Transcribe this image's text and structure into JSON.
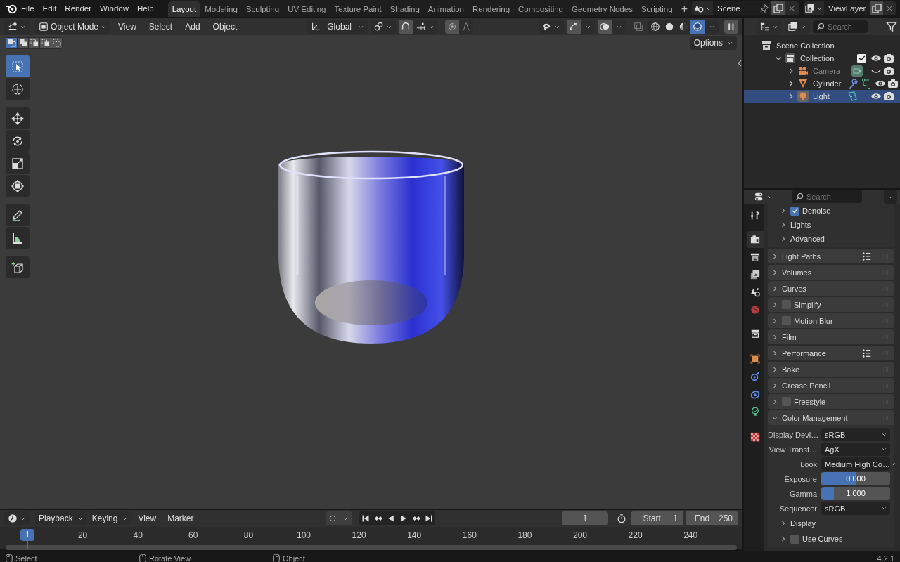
{
  "top_bar": {
    "menus": [
      "File",
      "Edit",
      "Render",
      "Window",
      "Help"
    ],
    "workspaces": [
      {
        "label": "Layout",
        "selected": true
      },
      {
        "label": "Modeling",
        "selected": false
      },
      {
        "label": "Sculpting",
        "selected": false
      },
      {
        "label": "UV Editing",
        "selected": false
      },
      {
        "label": "Texture Paint",
        "selected": false
      },
      {
        "label": "Shading",
        "selected": false
      },
      {
        "label": "Animation",
        "selected": false
      },
      {
        "label": "Rendering",
        "selected": false
      },
      {
        "label": "Compositing",
        "selected": false
      },
      {
        "label": "Geometry Nodes",
        "selected": false
      },
      {
        "label": "Scripting",
        "selected": false
      }
    ],
    "add_workspace": "+",
    "scene": "Scene",
    "view_layer": "ViewLayer"
  },
  "viewport": {
    "mode": "Object Mode",
    "menus": [
      "View",
      "Select",
      "Add",
      "Object"
    ],
    "orientation": "Global",
    "options": "Options",
    "select_modes": [
      {
        "kind": "set",
        "selected": true
      },
      {
        "kind": "extend",
        "selected": false
      },
      {
        "kind": "subtract",
        "selected": false
      },
      {
        "kind": "invert",
        "selected": false
      },
      {
        "kind": "intersect",
        "selected": false
      }
    ],
    "shading_modes": [
      {
        "kind": "wireframe",
        "selected": false
      },
      {
        "kind": "solid",
        "selected": false
      },
      {
        "kind": "material",
        "selected": false
      },
      {
        "kind": "rendered",
        "selected": true
      }
    ],
    "tools": [
      {
        "kind": "select",
        "selected": true
      },
      {
        "kind": "cursor",
        "selected": false
      },
      {
        "kind": "move",
        "selected": false
      },
      {
        "kind": "rotate",
        "selected": false
      },
      {
        "kind": "scale",
        "selected": false
      },
      {
        "kind": "transform",
        "selected": false
      },
      {
        "kind": "annotate",
        "selected": false
      },
      {
        "kind": "measure",
        "selected": false
      },
      {
        "kind": "add-cube",
        "selected": false
      }
    ]
  },
  "outliner": {
    "search_placeholder": "Search",
    "tree": [
      {
        "label": "Scene Collection",
        "kind": "scene-collection",
        "children": [
          {
            "label": "Collection",
            "kind": "collection",
            "expanded": true,
            "checked": true,
            "visible": true,
            "selected": false,
            "children": [
              {
                "label": "Camera",
                "kind": "camera",
                "expanded": false,
                "visible": false,
                "selected": false
              },
              {
                "label": "Cylinder",
                "kind": "mesh",
                "expanded": false,
                "visible": true,
                "selected": false
              },
              {
                "label": "Light",
                "kind": "light",
                "expanded": false,
                "visible": true,
                "selected": true
              }
            ]
          }
        ]
      }
    ]
  },
  "properties": {
    "search_placeholder": "Search",
    "tabs": [
      {
        "kind": "tool",
        "selected": false
      },
      {
        "kind": "render",
        "selected": true
      },
      {
        "kind": "output",
        "selected": false
      },
      {
        "kind": "view-layer",
        "selected": false
      },
      {
        "kind": "scene",
        "selected": false
      },
      {
        "kind": "world",
        "selected": false
      },
      {
        "kind": "collection",
        "selected": false
      },
      {
        "kind": "object",
        "selected": false
      },
      {
        "kind": "physics",
        "selected": false
      },
      {
        "kind": "constraints",
        "selected": false
      },
      {
        "kind": "light-data",
        "selected": false
      },
      {
        "kind": "texture",
        "selected": false
      }
    ],
    "subpanels": [
      {
        "label": "Denoise",
        "checked": true
      },
      {
        "label": "Lights"
      },
      {
        "label": "Advanced"
      }
    ],
    "panels": [
      {
        "label": "Light Paths",
        "expanded": false,
        "presets": true
      },
      {
        "label": "Volumes",
        "expanded": false
      },
      {
        "label": "Curves",
        "expanded": false
      },
      {
        "label": "Simplify",
        "expanded": false,
        "checked": false
      },
      {
        "label": "Motion Blur",
        "expanded": false,
        "checked": false
      },
      {
        "label": "Film",
        "expanded": false
      },
      {
        "label": "Performance",
        "expanded": false,
        "presets": true
      },
      {
        "label": "Bake",
        "expanded": false
      },
      {
        "label": "Grease Pencil",
        "expanded": false
      },
      {
        "label": "Freestyle",
        "expanded": false,
        "checked": false
      },
      {
        "label": "Color Management",
        "expanded": true,
        "fields": [
          {
            "kind": "dropdown",
            "label": "Display Devi…",
            "value": "sRGB"
          },
          {
            "kind": "dropdown",
            "label": "View Transf…",
            "value": "AgX"
          },
          {
            "kind": "dropdown",
            "label": "Look",
            "value": "Medium High Co…"
          },
          {
            "kind": "slider",
            "label": "Exposure",
            "value": "0.000",
            "level": 0.5
          },
          {
            "kind": "slider",
            "label": "Gamma",
            "value": "1.000",
            "level": 0.18
          },
          {
            "kind": "dropdown",
            "label": "Sequencer",
            "value": "sRGB"
          },
          {
            "kind": "subpanel",
            "label": "Display"
          },
          {
            "kind": "subpanel",
            "label": "Use Curves",
            "checked": false
          }
        ]
      }
    ]
  },
  "timeline": {
    "menus": [
      "Playback",
      "Keying",
      "View",
      "Marker"
    ],
    "current_frame": "1",
    "start_label": "Start",
    "start": "1",
    "end_label": "End",
    "end": "250",
    "playhead": "1",
    "ruler": [
      "20",
      "40",
      "60",
      "80",
      "100",
      "120",
      "140",
      "160",
      "180",
      "200",
      "220",
      "240"
    ]
  },
  "status_bar": {
    "hints": [
      {
        "kind": "left-click",
        "label": "Select"
      },
      {
        "kind": "middle-click",
        "label": "Rotate View"
      },
      {
        "kind": "right-click",
        "label": "Object"
      }
    ],
    "version": "4.2.1"
  }
}
